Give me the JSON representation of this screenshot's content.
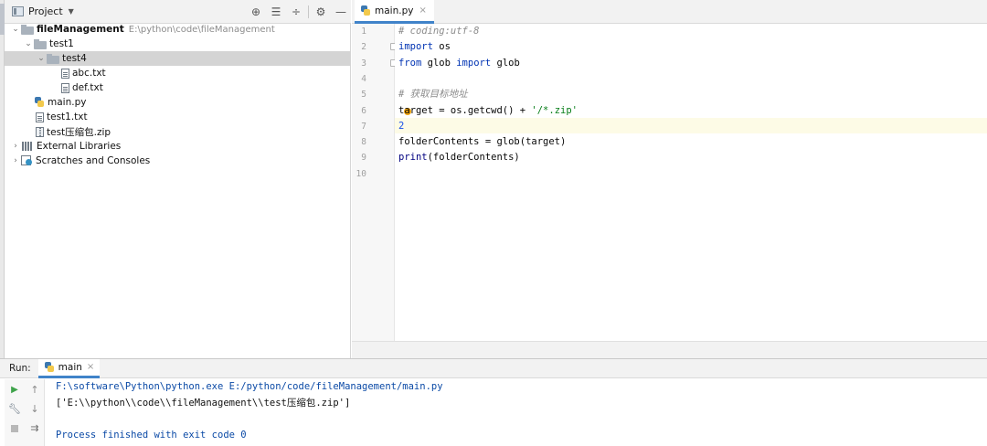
{
  "project": {
    "title": "Project",
    "tree": [
      {
        "label": "fileManagement",
        "path": "E:\\python\\code\\fileManagement",
        "type": "folder",
        "depth": 0,
        "expanded": true
      },
      {
        "label": "test1",
        "type": "folder",
        "depth": 1,
        "expanded": true
      },
      {
        "label": "test4",
        "type": "folder",
        "depth": 2,
        "expanded": true,
        "selected": true
      },
      {
        "label": "abc.txt",
        "type": "text-file",
        "depth": 3
      },
      {
        "label": "def.txt",
        "type": "text-file",
        "depth": 3
      },
      {
        "label": "main.py",
        "type": "python-file",
        "depth": 1
      },
      {
        "label": "test1.txt",
        "type": "text-file",
        "depth": 1
      },
      {
        "label": "test压缩包.zip",
        "type": "zip-file",
        "depth": 1
      },
      {
        "label": "External Libraries",
        "type": "library",
        "depth": 0,
        "expanded": false
      },
      {
        "label": "Scratches and Consoles",
        "type": "scratches",
        "depth": 0,
        "expanded": false
      }
    ]
  },
  "editor": {
    "tab_label": "main.py",
    "line_numbers": [
      "1",
      "2",
      "3",
      "4",
      "5",
      "6",
      "7",
      "8",
      "9",
      "10"
    ],
    "lines": [
      [
        {
          "t": "# coding:utf-8",
          "c": "cm"
        }
      ],
      [
        {
          "t": "import",
          "c": "kw"
        },
        {
          "t": " os",
          "c": ""
        }
      ],
      [
        {
          "t": "from",
          "c": "kw"
        },
        {
          "t": " glob ",
          "c": ""
        },
        {
          "t": "import",
          "c": "kw"
        },
        {
          "t": " glob",
          "c": ""
        }
      ],
      [],
      [
        {
          "t": "# 获取目标地址",
          "c": "cm"
        }
      ],
      [
        {
          "t": "target = os.getcwd() + ",
          "c": ""
        },
        {
          "t": "'/*.zip'",
          "c": "str"
        }
      ],
      [
        {
          "t": "2",
          "c": "num"
        }
      ],
      [
        {
          "t": "folderContents = glob(target)",
          "c": ""
        }
      ],
      [
        {
          "t": "print",
          "c": "fn"
        },
        {
          "t": "(folderContents)",
          "c": ""
        }
      ],
      []
    ]
  },
  "run": {
    "title": "Run:",
    "tab_label": "main",
    "console": [
      "F:\\software\\Python\\python.exe E:/python/code/fileManagement/main.py",
      "['E:\\\\python\\\\code\\\\fileManagement\\\\test压缩包.zip']",
      "",
      "Process finished with exit code 0"
    ]
  },
  "colors": {
    "accent": "#4083c9",
    "keyword": "#0033b3",
    "comment": "#8c8c8c",
    "string": "#067d17",
    "number": "#1750eb",
    "selection": "#d4d4d4"
  }
}
